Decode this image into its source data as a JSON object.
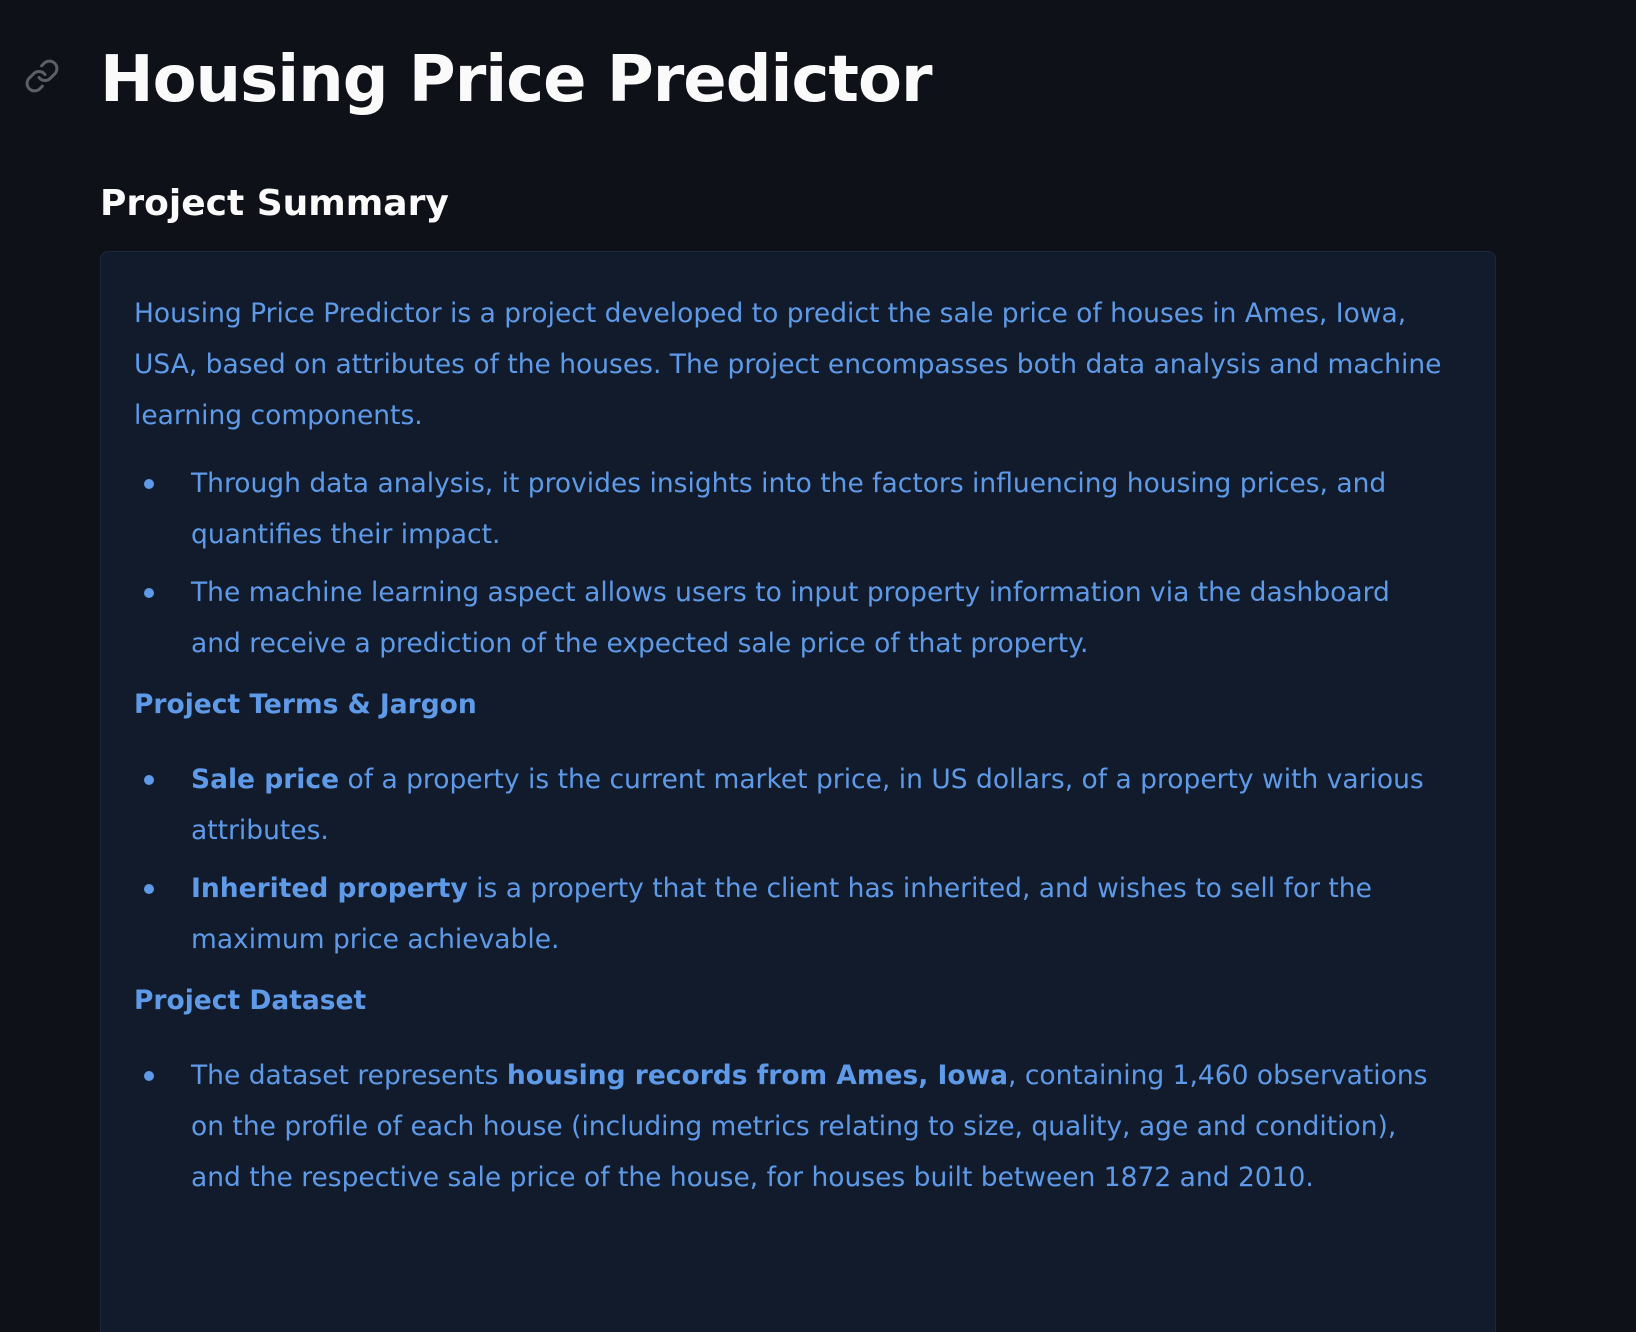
{
  "header": {
    "title": "Housing Price Predictor",
    "link_icon": "link-icon"
  },
  "section": {
    "title": "Project Summary"
  },
  "summary": {
    "intro": "Housing Price Predictor is a project developed to predict the sale price of houses in Ames, Iowa, USA, based on attributes of the houses. The project encompasses both data analysis and machine learning components.",
    "bullets": [
      "Through data analysis, it provides insights into the factors influencing housing prices, and quantifies their impact.",
      "The machine learning aspect allows users to input property information via the dashboard and receive a prediction of the expected sale price of that property."
    ]
  },
  "terms": {
    "heading": "Project Terms & Jargon",
    "items": [
      {
        "term": "Sale price",
        "text": " of a property is the current market price, in US dollars, of a property with various attributes."
      },
      {
        "term": "Inherited property",
        "text": " is a property that the client has inherited, and wishes to sell for the maximum price achievable."
      }
    ]
  },
  "dataset": {
    "heading": "Project Dataset",
    "items": [
      {
        "prefix": "The dataset represents ",
        "bold": "housing records from Ames, Iowa",
        "suffix": ", containing 1,460 observations on the profile of each house (including metrics relating to size, quality, age and condition), and the respective sale price of the house, for houses built between 1872 and 2010."
      }
    ]
  },
  "colors": {
    "background": "#0e1117",
    "box_background": "#111b2b",
    "text_accent": "#5f9ae8",
    "heading_text": "#fafafa"
  }
}
